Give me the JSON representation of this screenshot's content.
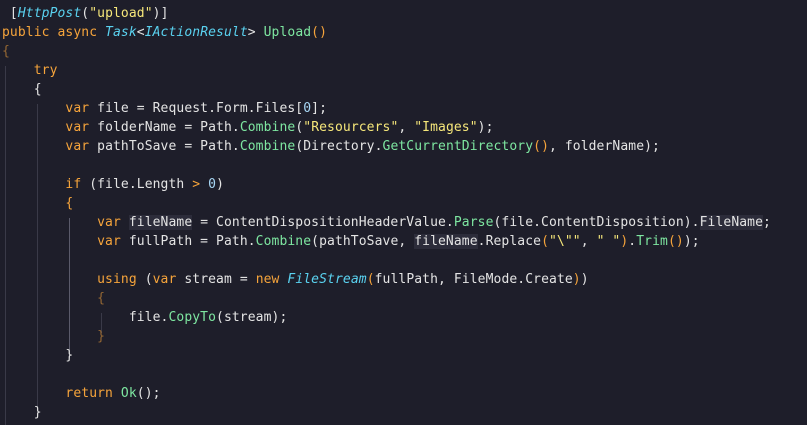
{
  "colors": {
    "background": "#1e1e2a",
    "plain": "#e4e4e4",
    "keyword": "#f6a43b",
    "string": "#f6e77a",
    "number": "#a8d7f5",
    "type": "#5ad2f0",
    "method": "#7ee7a1",
    "bracket": "#f6a43b"
  },
  "code": {
    "lines": [
      {
        "tokens": [
          {
            "t": " [",
            "k": "plain"
          },
          {
            "t": "HttpPost",
            "k": "type-italic"
          },
          {
            "t": "(",
            "k": "plain"
          },
          {
            "t": "\"upload\"",
            "k": "string"
          },
          {
            "t": ")]",
            "k": "plain"
          }
        ]
      },
      {
        "tokens": [
          {
            "t": "public async ",
            "k": "keyword"
          },
          {
            "t": "Task",
            "k": "type-italic"
          },
          {
            "t": "<",
            "k": "plain"
          },
          {
            "t": "IActionResult",
            "k": "type-italic"
          },
          {
            "t": "> ",
            "k": "plain"
          },
          {
            "t": "Upload",
            "k": "method"
          },
          {
            "t": "()",
            "k": "bracket"
          }
        ]
      },
      {
        "tokens": [
          {
            "t": "{",
            "k": "bracket-dim"
          }
        ]
      },
      {
        "tokens": [
          {
            "t": "    ",
            "k": "plain"
          },
          {
            "t": "try",
            "k": "keyword"
          }
        ]
      },
      {
        "tokens": [
          {
            "t": "    ",
            "k": "plain"
          },
          {
            "t": "{",
            "k": "plain"
          }
        ]
      },
      {
        "tokens": [
          {
            "t": "        ",
            "k": "plain"
          },
          {
            "t": "var ",
            "k": "keyword"
          },
          {
            "t": "file = Request.Form.Files[",
            "k": "plain"
          },
          {
            "t": "0",
            "k": "number"
          },
          {
            "t": "];",
            "k": "plain"
          }
        ]
      },
      {
        "tokens": [
          {
            "t": "        ",
            "k": "plain"
          },
          {
            "t": "var ",
            "k": "keyword"
          },
          {
            "t": "folderName = Path.",
            "k": "plain"
          },
          {
            "t": "Combine",
            "k": "method"
          },
          {
            "t": "(",
            "k": "plain"
          },
          {
            "t": "\"Resourcers\"",
            "k": "string"
          },
          {
            "t": ", ",
            "k": "plain"
          },
          {
            "t": "\"Images\"",
            "k": "string"
          },
          {
            "t": ");",
            "k": "plain"
          }
        ]
      },
      {
        "tokens": [
          {
            "t": "        ",
            "k": "plain"
          },
          {
            "t": "var ",
            "k": "keyword"
          },
          {
            "t": "pathToSave = Path.",
            "k": "plain"
          },
          {
            "t": "Combine",
            "k": "method"
          },
          {
            "t": "(Directory.",
            "k": "plain"
          },
          {
            "t": "GetCurrentDirectory",
            "k": "method"
          },
          {
            "t": "()",
            "k": "bracket"
          },
          {
            "t": ", folderName);",
            "k": "plain"
          }
        ]
      },
      {
        "tokens": [
          {
            "t": "",
            "k": "plain"
          }
        ]
      },
      {
        "tokens": [
          {
            "t": "        ",
            "k": "plain"
          },
          {
            "t": "if ",
            "k": "keyword"
          },
          {
            "t": "(file.Length ",
            "k": "plain"
          },
          {
            "t": ">",
            "k": "keyword"
          },
          {
            "t": " ",
            "k": "plain"
          },
          {
            "t": "0",
            "k": "number"
          },
          {
            "t": ")",
            "k": "plain"
          }
        ]
      },
      {
        "tokens": [
          {
            "t": "        ",
            "k": "plain"
          },
          {
            "t": "{",
            "k": "bracket"
          }
        ]
      },
      {
        "tokens": [
          {
            "t": "            ",
            "k": "plain"
          },
          {
            "t": "var ",
            "k": "keyword"
          },
          {
            "t": "fileName",
            "k": "plain-highlight"
          },
          {
            "t": " = ContentDispositionHeaderValue.",
            "k": "plain"
          },
          {
            "t": "Parse",
            "k": "method"
          },
          {
            "t": "(file.ContentDisposition)",
            "k": "plain"
          },
          {
            "t": ".",
            "k": "plain"
          },
          {
            "t": "FileName",
            "k": "plain-highlight"
          },
          {
            "t": ";",
            "k": "plain"
          }
        ]
      },
      {
        "tokens": [
          {
            "t": "            ",
            "k": "plain"
          },
          {
            "t": "var ",
            "k": "keyword"
          },
          {
            "t": "fullPath = Path.",
            "k": "plain"
          },
          {
            "t": "Combine",
            "k": "method"
          },
          {
            "t": "(pathToSave, ",
            "k": "plain"
          },
          {
            "t": "fileName",
            "k": "plain-highlight"
          },
          {
            "t": ".Replace",
            "k": "plain"
          },
          {
            "t": "(",
            "k": "bracket"
          },
          {
            "t": "\"\\\"\"",
            "k": "string"
          },
          {
            "t": ", ",
            "k": "plain"
          },
          {
            "t": "\" \"",
            "k": "string"
          },
          {
            "t": ")",
            "k": "bracket"
          },
          {
            "t": ".",
            "k": "plain"
          },
          {
            "t": "Trim",
            "k": "method"
          },
          {
            "t": "()",
            "k": "bracket"
          },
          {
            "t": ");",
            "k": "plain"
          }
        ]
      },
      {
        "tokens": [
          {
            "t": "",
            "k": "plain"
          }
        ]
      },
      {
        "tokens": [
          {
            "t": "            ",
            "k": "plain"
          },
          {
            "t": "using ",
            "k": "keyword"
          },
          {
            "t": "(",
            "k": "plain"
          },
          {
            "t": "var ",
            "k": "keyword"
          },
          {
            "t": "stream = ",
            "k": "plain"
          },
          {
            "t": "new ",
            "k": "keyword"
          },
          {
            "t": "FileStream",
            "k": "type-italic"
          },
          {
            "t": "(",
            "k": "bracket"
          },
          {
            "t": "fullPath, FileMode.Create",
            "k": "plain"
          },
          {
            "t": ")",
            "k": "bracket"
          },
          {
            "t": ")",
            "k": "plain"
          }
        ]
      },
      {
        "tokens": [
          {
            "t": "            ",
            "k": "plain"
          },
          {
            "t": "{",
            "k": "bracket-dim"
          }
        ]
      },
      {
        "tokens": [
          {
            "t": "                ",
            "k": "plain"
          },
          {
            "t": "file.",
            "k": "plain"
          },
          {
            "t": "CopyTo",
            "k": "method"
          },
          {
            "t": "(stream);",
            "k": "plain"
          }
        ]
      },
      {
        "tokens": [
          {
            "t": "            ",
            "k": "plain"
          },
          {
            "t": "}",
            "k": "bracket-dim"
          }
        ]
      },
      {
        "tokens": [
          {
            "t": "        ",
            "k": "plain"
          },
          {
            "t": "}",
            "k": "plain"
          }
        ]
      },
      {
        "tokens": [
          {
            "t": "",
            "k": "plain"
          }
        ]
      },
      {
        "tokens": [
          {
            "t": "        ",
            "k": "plain"
          },
          {
            "t": "return ",
            "k": "keyword"
          },
          {
            "t": "Ok",
            "k": "method"
          },
          {
            "t": "();",
            "k": "plain"
          }
        ]
      },
      {
        "tokens": [
          {
            "t": "    ",
            "k": "plain"
          },
          {
            "t": "}",
            "k": "plain"
          }
        ]
      }
    ]
  }
}
